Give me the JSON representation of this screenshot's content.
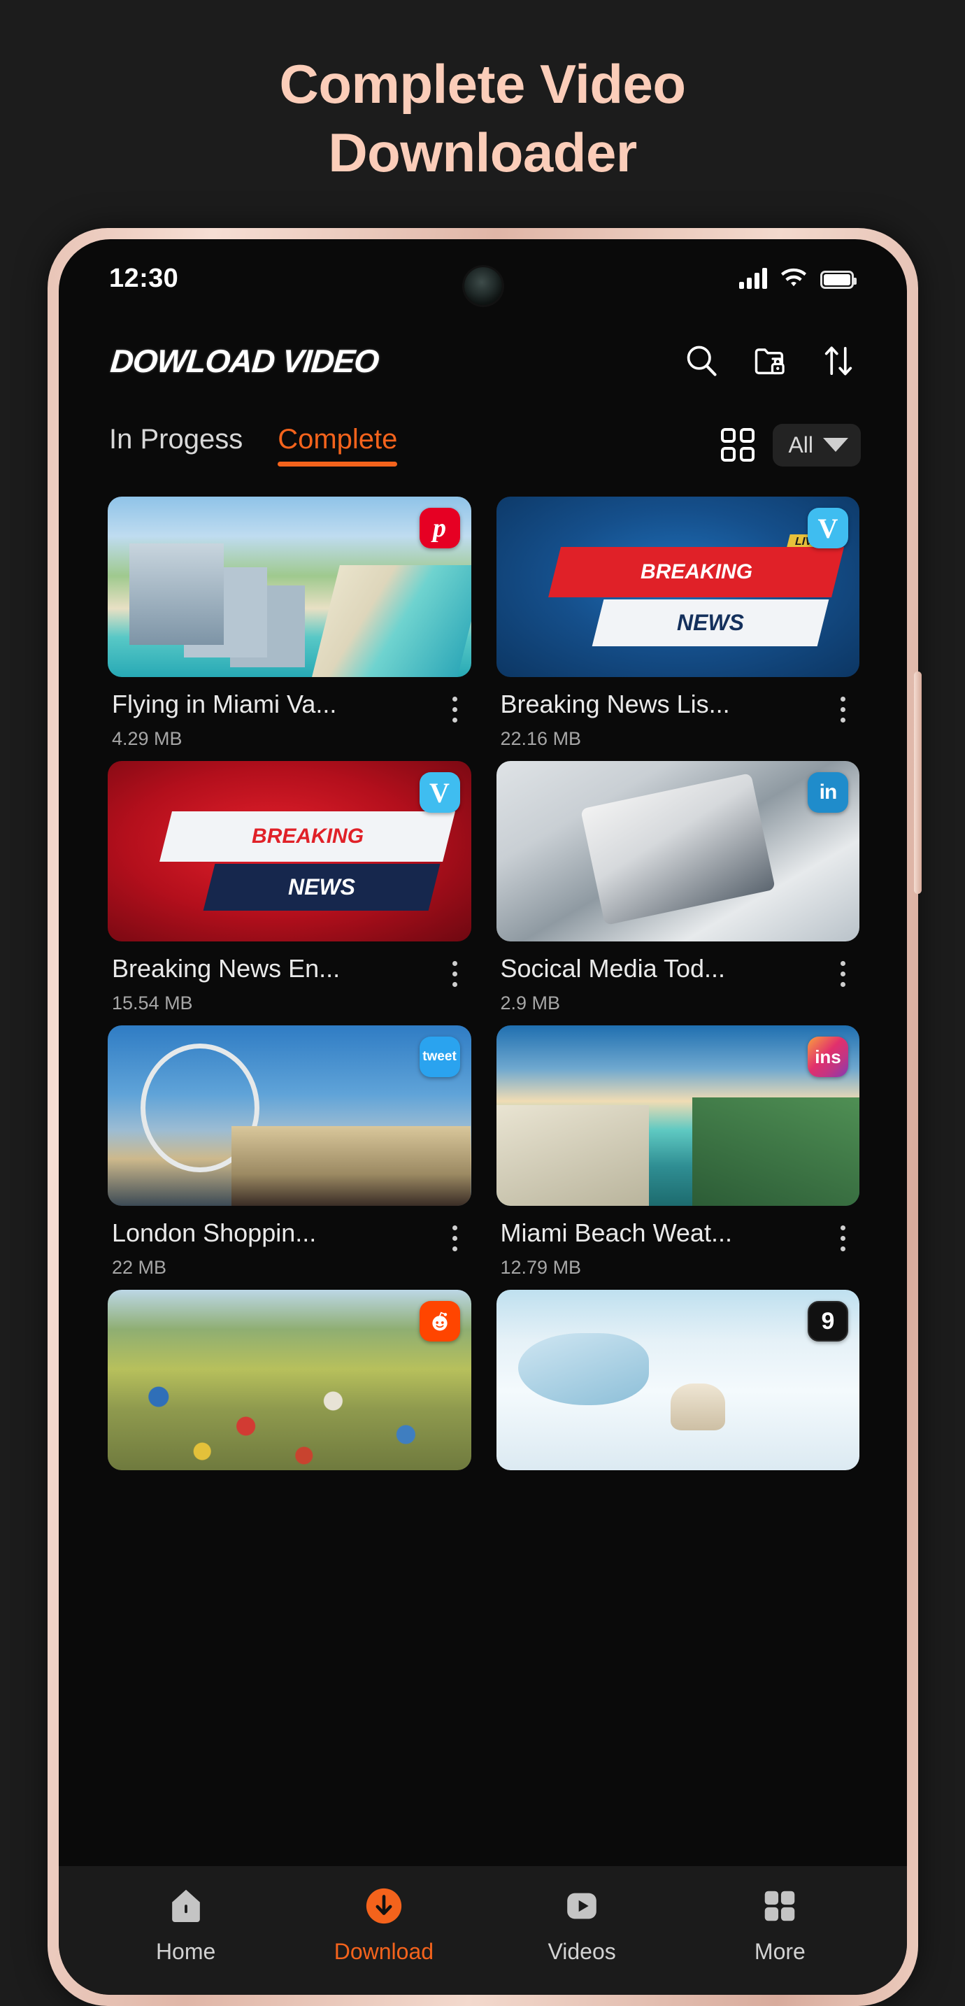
{
  "promo": {
    "line1": "Complete Video",
    "line2": "Downloader",
    "color": "#fbcdb9"
  },
  "statusbar": {
    "time": "12:30",
    "signal_icon": "signal-bars-icon",
    "wifi_icon": "wifi-icon",
    "battery_icon": "battery-full-icon"
  },
  "header": {
    "brand": "DOWLOAD VIDEO",
    "actions": [
      {
        "name": "search-icon",
        "label": "Search"
      },
      {
        "name": "locked-folder-icon",
        "label": "Private folder"
      },
      {
        "name": "sort-arrows-icon",
        "label": "Sort"
      }
    ]
  },
  "tabs": {
    "items": [
      {
        "label": "In Progess",
        "active": false
      },
      {
        "label": "Complete",
        "active": true
      }
    ],
    "active_color": "#f4631c",
    "grid_view_icon": "grid-view-icon",
    "filter": {
      "label": "All",
      "caret": "chevron-down-icon"
    }
  },
  "videos": [
    {
      "title": "Flying in Miami Va...",
      "size": "4.29 MB",
      "source": "pinterest",
      "badge_text": "p",
      "art": "art-miami"
    },
    {
      "title": "Breaking News Lis...",
      "size": "22.16 MB",
      "source": "vimeo",
      "badge_text": "V",
      "art": "art-bnews-blue",
      "overlay": "breaking-news-blue",
      "live_label": "LIVE",
      "band1": "BREAKING",
      "band2": "NEWS"
    },
    {
      "title": "Breaking News En...",
      "size": "15.54 MB",
      "source": "vimeo",
      "badge_text": "V",
      "art": "art-bnews-red",
      "overlay": "breaking-news-red",
      "band1": "BREAKING",
      "band2": "NEWS"
    },
    {
      "title": "Socical Media Tod...",
      "size": "2.9 MB",
      "source": "linkedin",
      "badge_text": "in",
      "art": "art-linkedin"
    },
    {
      "title": "London Shoppin...",
      "size": "22 MB",
      "source": "twitter",
      "badge_text": "tweet",
      "art": "art-london"
    },
    {
      "title": "Miami Beach Weat...",
      "size": "12.79 MB",
      "source": "instagram",
      "badge_text": "ins",
      "art": "art-miami2"
    },
    {
      "title": "",
      "size": "",
      "source": "reddit",
      "badge_text": "●",
      "art": "art-greenland"
    },
    {
      "title": "",
      "size": "",
      "source": "ninegag",
      "badge_text": "9",
      "art": "art-bear"
    }
  ],
  "bottomnav": {
    "items": [
      {
        "label": "Home",
        "icon": "home-icon",
        "active": false
      },
      {
        "label": "Download",
        "icon": "download-arrow-icon",
        "active": true
      },
      {
        "label": "Videos",
        "icon": "video-play-icon",
        "active": false
      },
      {
        "label": "More",
        "icon": "more-grid-icon",
        "active": false
      }
    ],
    "active_color": "#f4631c"
  }
}
